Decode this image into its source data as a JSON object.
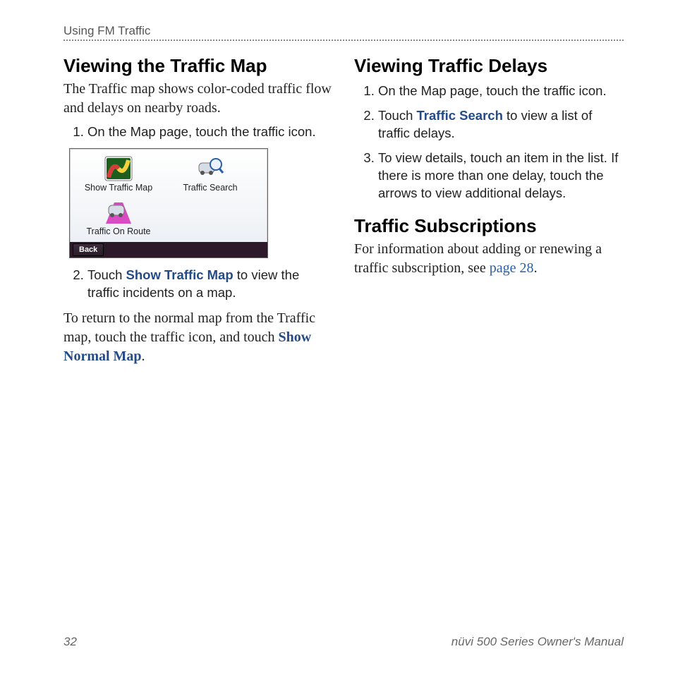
{
  "running_head": "Using FM Traffic",
  "left": {
    "heading": "Viewing the Traffic Map",
    "intro": "The Traffic map shows color-coded traffic flow and delays on nearby roads.",
    "step1": "On the Map page, touch the traffic icon.",
    "step2_pre": "Touch ",
    "step2_kw": "Show Traffic Map",
    "step2_post": " to view the traffic incidents on a map.",
    "closing_pre": "To return to the normal map from the Traffic map, touch the traffic icon, and touch ",
    "closing_kw": "Show Normal Map",
    "closing_post": "."
  },
  "device": {
    "btn1": "Show Traffic Map",
    "btn2": "Traffic Search",
    "btn3": "Traffic On Route",
    "back": "Back"
  },
  "right": {
    "heading1": "Viewing Traffic Delays",
    "d_step1": "On the Map page, touch the traffic icon.",
    "d_step2_pre": "Touch ",
    "d_step2_kw": "Traffic Search",
    "d_step2_post": " to view a list of traffic delays.",
    "d_step3": "To view details, touch an item in the list. If there is more than one delay, touch the arrows to view additional delays.",
    "heading2": "Traffic Subscriptions",
    "subs_pre": "For information about adding or renewing a traffic subscription, see ",
    "subs_link": "page 28",
    "subs_post": "."
  },
  "footer": {
    "page_num": "32",
    "product": "nüvi 500 Series Owner's Manual"
  }
}
